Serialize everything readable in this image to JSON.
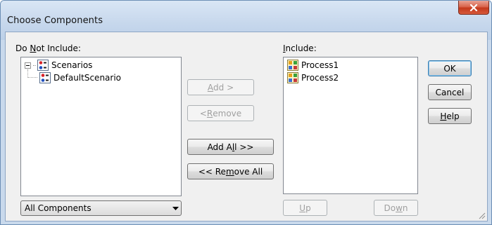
{
  "window": {
    "title": "Choose Components",
    "close_label": "X"
  },
  "left_panel": {
    "label_prefix": "Do ",
    "label_accel": "N",
    "label_rest": "ot Include:",
    "tree": [
      {
        "label": "Scenarios",
        "icon": "scenario-icon",
        "expanded": true
      },
      {
        "label": "DefaultScenario",
        "icon": "scenario-icon"
      }
    ],
    "filter": {
      "selected": "All Components"
    }
  },
  "middle_buttons": {
    "add": {
      "pre": "",
      "accel": "A",
      "post": "dd >",
      "enabled": false
    },
    "remove": {
      "pre": "< ",
      "accel": "R",
      "post": "emove",
      "enabled": false
    },
    "add_all": {
      "pre": "Add A",
      "accel": "l",
      "post": "l >>",
      "enabled": true
    },
    "remove_all": {
      "pre": "<< Re",
      "accel": "m",
      "post": "ove All",
      "enabled": true
    }
  },
  "right_panel": {
    "label_accel": "I",
    "label_rest": "nclude:",
    "items": [
      {
        "label": "Process1",
        "icon": "process-icon"
      },
      {
        "label": "Process2",
        "icon": "process-icon"
      }
    ],
    "up": {
      "accel": "U",
      "post": "p",
      "enabled": false
    },
    "down": {
      "pre": "Do",
      "accel": "w",
      "post": "n",
      "enabled": false
    }
  },
  "dialog_buttons": {
    "ok": "OK",
    "cancel": "Cancel",
    "help_accel": "H",
    "help_rest": "elp"
  }
}
